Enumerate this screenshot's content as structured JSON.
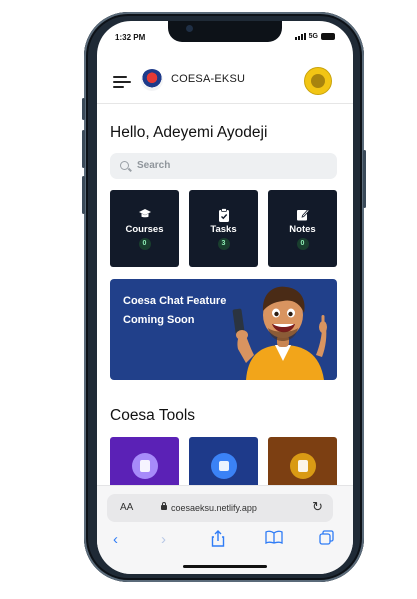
{
  "status_bar": {
    "time": "1:32 PM",
    "network": "5G"
  },
  "header": {
    "app_name": "COESA-EKSU"
  },
  "greeting": "Hello, Adeyemi Ayodeji",
  "search": {
    "placeholder": "Search"
  },
  "stats": [
    {
      "label": "Courses",
      "count": "0",
      "icon": "graduation-cap-icon"
    },
    {
      "label": "Tasks",
      "count": "3",
      "icon": "clipboard-check-icon"
    },
    {
      "label": "Notes",
      "count": "0",
      "icon": "note-edit-icon"
    }
  ],
  "banner": {
    "text": "Coesa Chat Feature Coming Soon"
  },
  "tools": {
    "title": "Coesa Tools",
    "items": [
      {
        "icon": "calculator-icon",
        "color": "#5b21b6",
        "circle": "#a78bfa"
      },
      {
        "icon": "chip-icon",
        "color": "#1e3a8a",
        "circle": "#3b82f6"
      },
      {
        "icon": "document-icon",
        "color": "#7c3f12",
        "circle": "#d99a14"
      }
    ]
  },
  "browser": {
    "aa_label": "AA",
    "url": "coesaeksu.netlify.app"
  },
  "colors": {
    "card_bg": "#121a29",
    "banner_bg": "#21408a",
    "safari_blue": "#2f7cf6"
  }
}
